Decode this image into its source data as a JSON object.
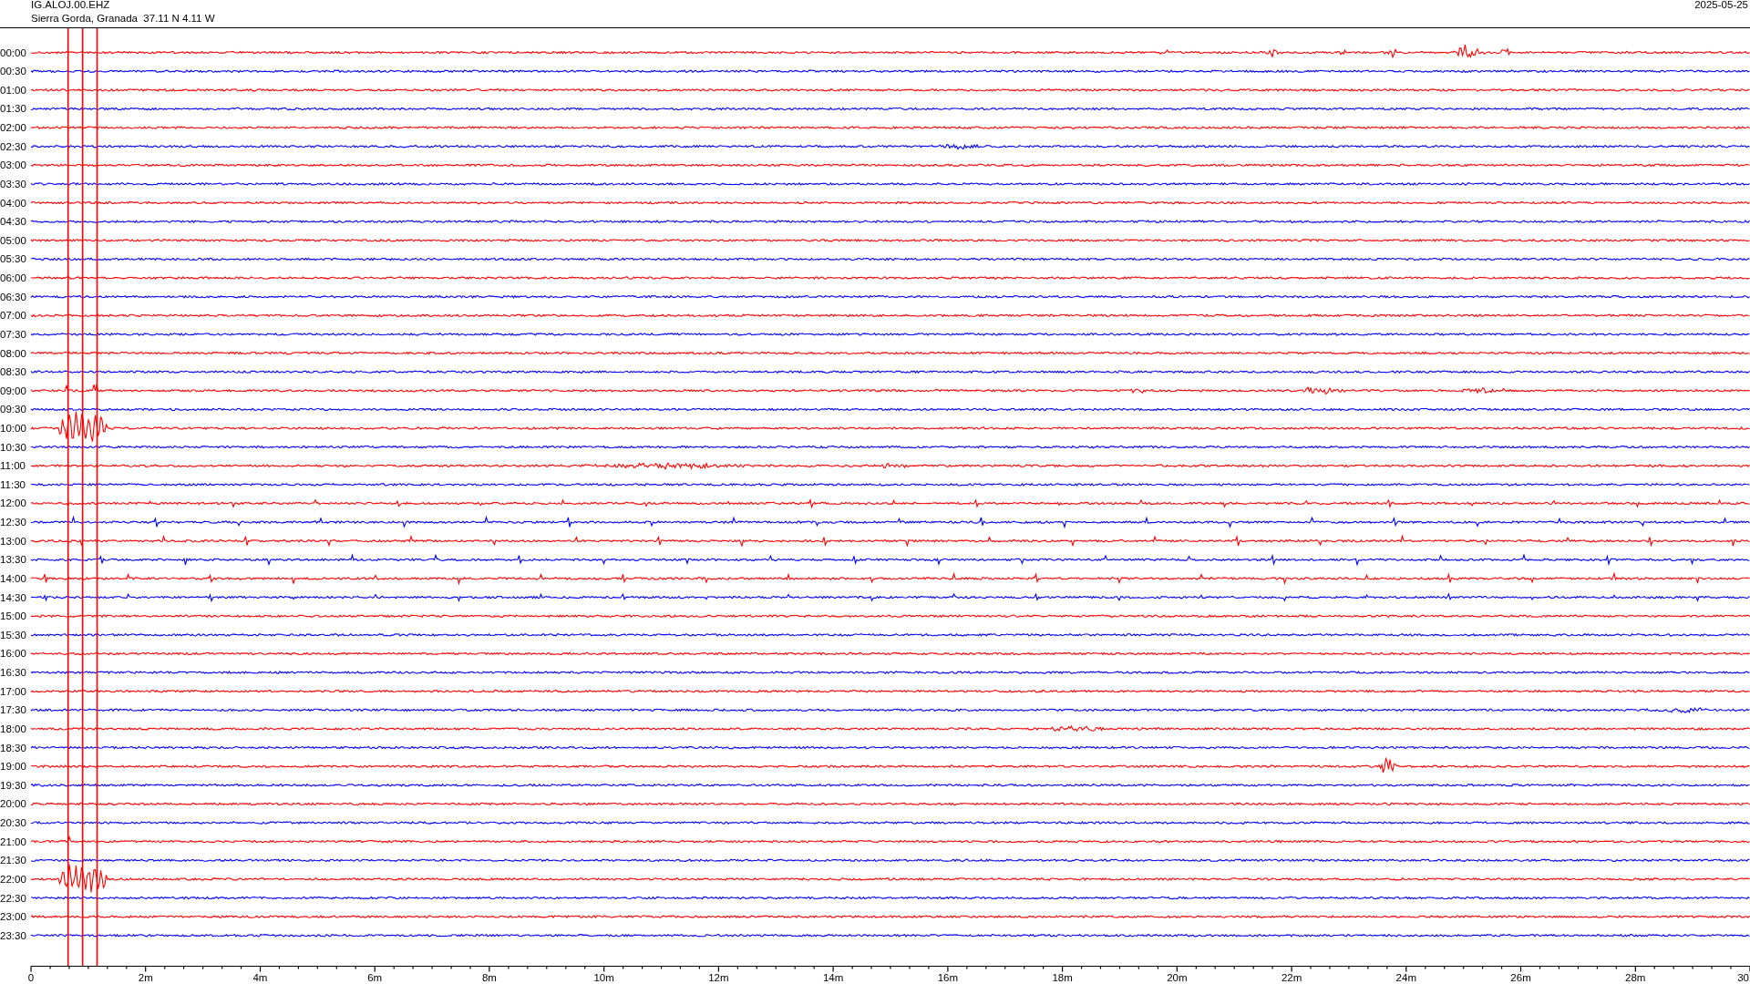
{
  "header": {
    "station": "IG.ALOJ.00.EHZ",
    "location": "Sierra Gorda, Granada  37.11 N 4.11 W",
    "date": "2025-05-25"
  },
  "rows": [
    {
      "label": "00:00",
      "color": "#ff0000"
    },
    {
      "label": "00:30",
      "color": "#0000ff"
    },
    {
      "label": "01:00",
      "color": "#ff0000"
    },
    {
      "label": "01:30",
      "color": "#0000ff"
    },
    {
      "label": "02:00",
      "color": "#ff0000"
    },
    {
      "label": "02:30",
      "color": "#0000ff"
    },
    {
      "label": "03:00",
      "color": "#ff0000"
    },
    {
      "label": "03:30",
      "color": "#0000ff"
    },
    {
      "label": "04:00",
      "color": "#ff0000"
    },
    {
      "label": "04:30",
      "color": "#0000ff"
    },
    {
      "label": "05:00",
      "color": "#ff0000"
    },
    {
      "label": "05:30",
      "color": "#0000ff"
    },
    {
      "label": "06:00",
      "color": "#ff0000"
    },
    {
      "label": "06:30",
      "color": "#0000ff"
    },
    {
      "label": "07:00",
      "color": "#ff0000"
    },
    {
      "label": "07:30",
      "color": "#0000ff"
    },
    {
      "label": "08:00",
      "color": "#ff0000"
    },
    {
      "label": "08:30",
      "color": "#0000ff"
    },
    {
      "label": "09:00",
      "color": "#ff0000"
    },
    {
      "label": "09:30",
      "color": "#0000ff"
    },
    {
      "label": "10:00",
      "color": "#ff0000"
    },
    {
      "label": "10:30",
      "color": "#0000ff"
    },
    {
      "label": "11:00",
      "color": "#ff0000"
    },
    {
      "label": "11:30",
      "color": "#0000ff"
    },
    {
      "label": "12:00",
      "color": "#ff0000"
    },
    {
      "label": "12:30",
      "color": "#0000ff"
    },
    {
      "label": "13:00",
      "color": "#ff0000"
    },
    {
      "label": "13:30",
      "color": "#0000ff"
    },
    {
      "label": "14:00",
      "color": "#ff0000"
    },
    {
      "label": "14:30",
      "color": "#0000ff"
    },
    {
      "label": "15:00",
      "color": "#ff0000"
    },
    {
      "label": "15:30",
      "color": "#0000ff"
    },
    {
      "label": "16:00",
      "color": "#ff0000"
    },
    {
      "label": "16:30",
      "color": "#0000ff"
    },
    {
      "label": "17:00",
      "color": "#ff0000"
    },
    {
      "label": "17:30",
      "color": "#0000ff"
    },
    {
      "label": "18:00",
      "color": "#ff0000"
    },
    {
      "label": "18:30",
      "color": "#0000ff"
    },
    {
      "label": "19:00",
      "color": "#ff0000"
    },
    {
      "label": "19:30",
      "color": "#0000ff"
    },
    {
      "label": "20:00",
      "color": "#ff0000"
    },
    {
      "label": "20:30",
      "color": "#0000ff"
    },
    {
      "label": "21:00",
      "color": "#ff0000"
    },
    {
      "label": "21:30",
      "color": "#0000ff"
    },
    {
      "label": "22:00",
      "color": "#ff0000"
    },
    {
      "label": "22:30",
      "color": "#0000ff"
    },
    {
      "label": "23:00",
      "color": "#ff0000"
    },
    {
      "label": "23:30",
      "color": "#0000ff"
    }
  ],
  "axis": {
    "ticks": [
      "0",
      "2m",
      "4m",
      "6m",
      "8m",
      "10m",
      "12m",
      "14m",
      "16m",
      "18m",
      "20m",
      "22m",
      "24m",
      "26m",
      "28m",
      "30"
    ]
  }
}
